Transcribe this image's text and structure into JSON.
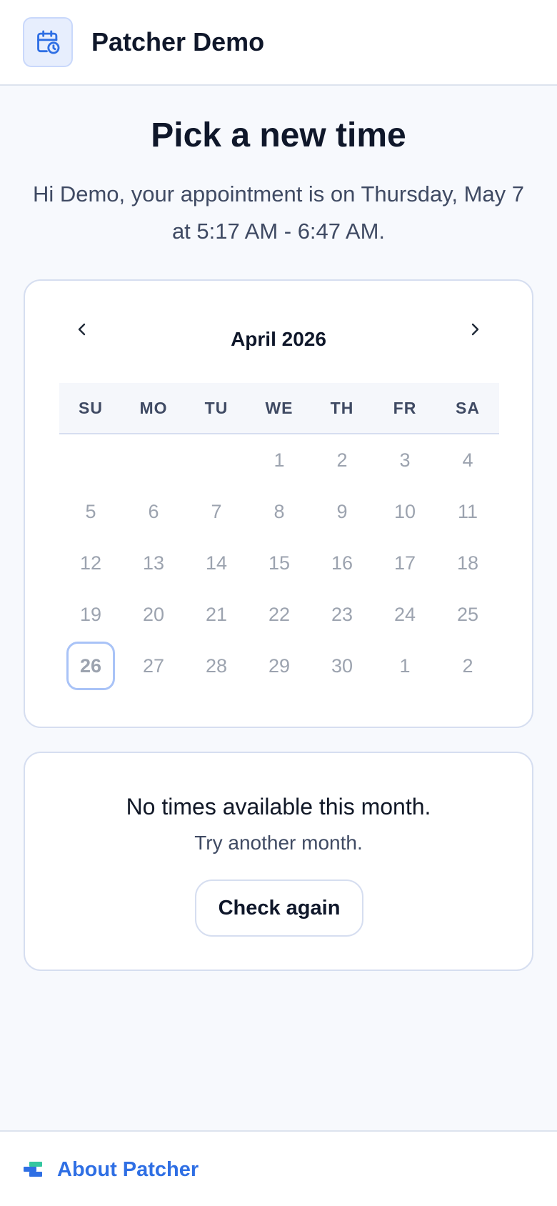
{
  "header": {
    "app_title": "Patcher Demo",
    "logo_icon": "calendar-clock-icon",
    "accent_color": "#2f6fe4"
  },
  "main": {
    "title": "Pick a new time",
    "subtitle": "Hi Demo, your appointment is on Thursday, May 7 at 5:17 AM - 6:47 AM."
  },
  "calendar": {
    "month_label": "April 2026",
    "prev_icon": "chevron-left-icon",
    "next_icon": "chevron-right-icon",
    "weekdays": [
      "SU",
      "MO",
      "TU",
      "WE",
      "TH",
      "FR",
      "SA"
    ],
    "days": [
      "",
      "",
      "",
      "1",
      "2",
      "3",
      "4",
      "5",
      "6",
      "7",
      "8",
      "9",
      "10",
      "11",
      "12",
      "13",
      "14",
      "15",
      "16",
      "17",
      "18",
      "19",
      "20",
      "21",
      "22",
      "23",
      "24",
      "25",
      "26",
      "27",
      "28",
      "29",
      "30",
      "1",
      "2"
    ],
    "today": "26"
  },
  "availability": {
    "message": "No times available this month.",
    "hint": "Try another month.",
    "button_label": "Check again"
  },
  "footer": {
    "link_label": "About Patcher"
  }
}
